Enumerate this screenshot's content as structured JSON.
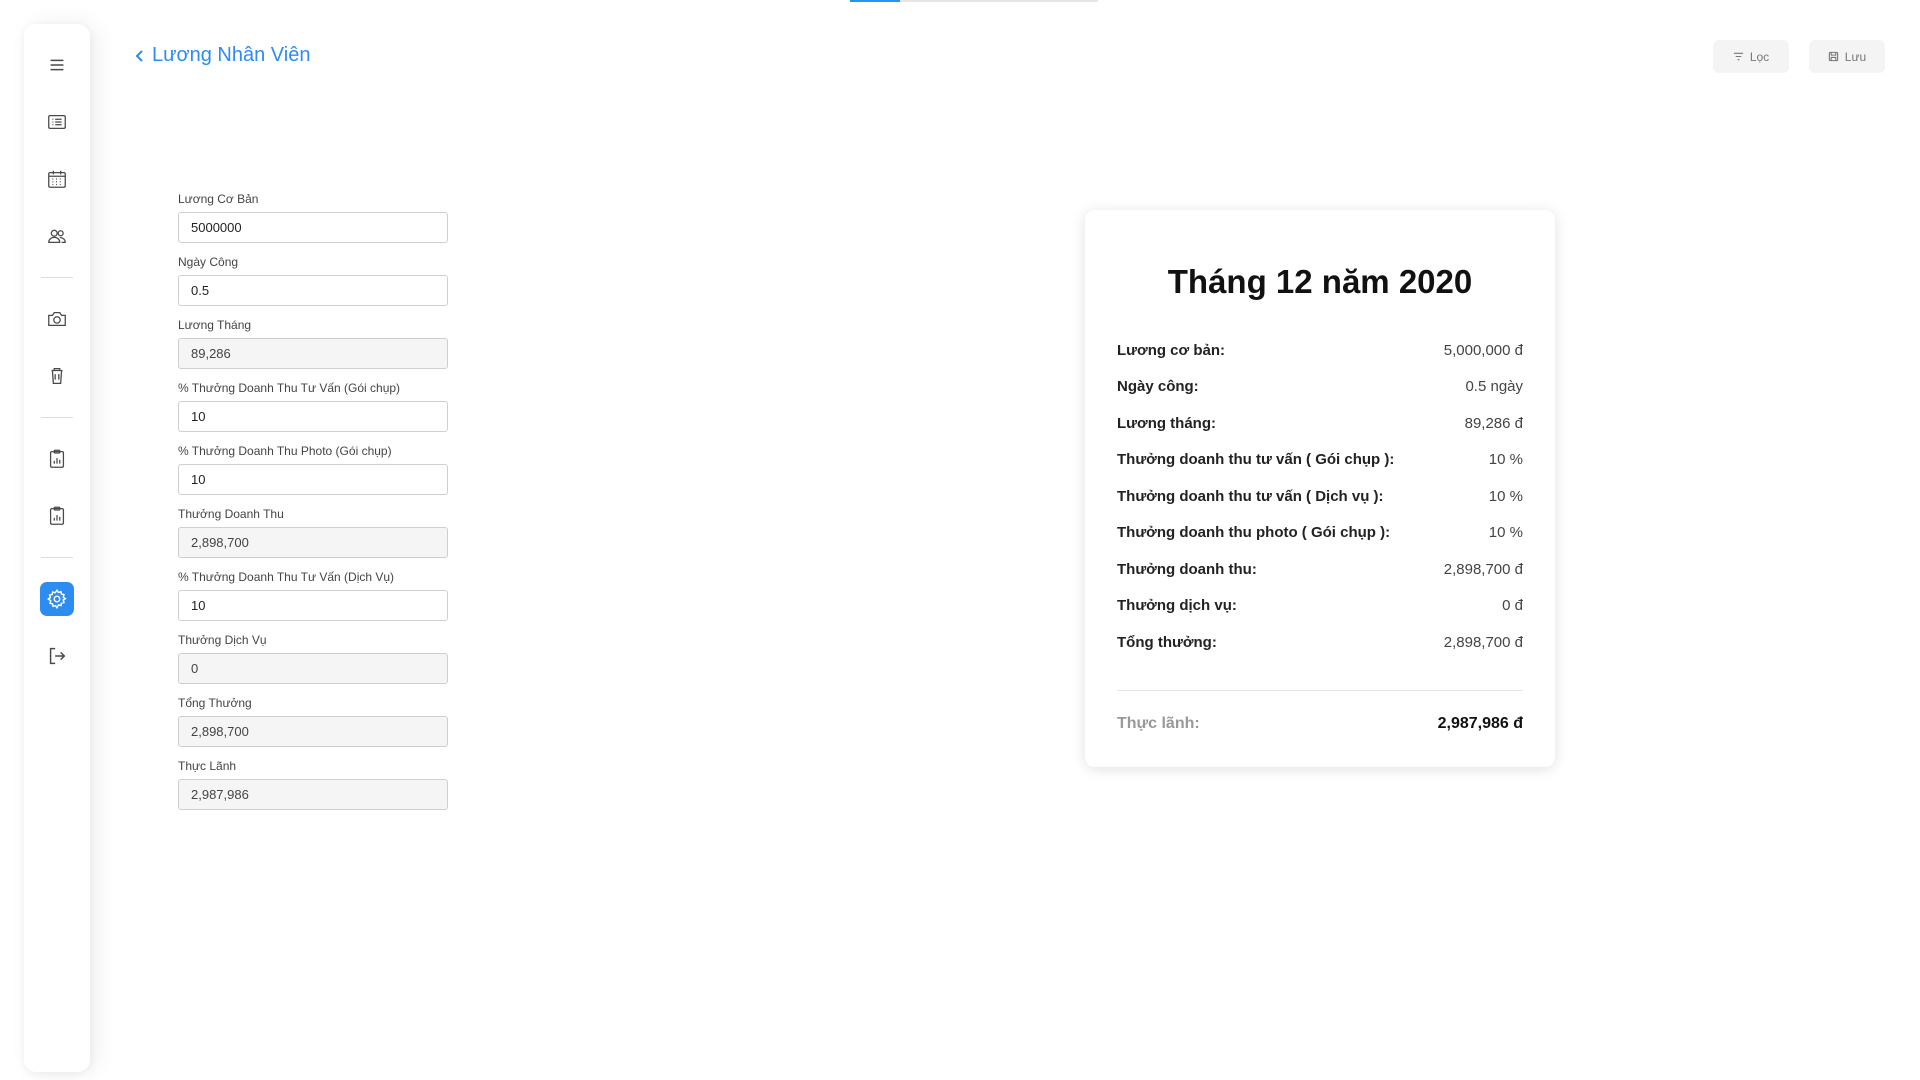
{
  "progress": {
    "fraction": 0.2
  },
  "sidebar": {
    "items": [
      {
        "icon": "menu-icon"
      },
      {
        "icon": "list-icon"
      },
      {
        "icon": "calendar-icon"
      },
      {
        "icon": "users-icon"
      },
      {
        "icon": "camera-icon"
      },
      {
        "icon": "trash-icon"
      },
      {
        "icon": "clipboard-chart-icon"
      },
      {
        "icon": "clipboard-chart-icon"
      },
      {
        "icon": "gear-icon",
        "active": true
      },
      {
        "icon": "logout-icon"
      }
    ],
    "accent": "#2d8cf0"
  },
  "header": {
    "title": "Lương Nhân Viên",
    "filter_label": "Lọc",
    "save_label": "Lưu"
  },
  "form": {
    "fields": [
      {
        "label": "Lương Cơ Bản",
        "value": "5000000",
        "readonly": false
      },
      {
        "label": "Ngày Công",
        "value": "0.5",
        "readonly": false
      },
      {
        "label": "Lương Tháng",
        "value": "89,286",
        "readonly": true
      },
      {
        "label": "% Thưởng Doanh Thu Tư Vấn (Gói chụp)",
        "value": "10",
        "readonly": false
      },
      {
        "label": "% Thưởng Doanh Thu Photo (Gói chụp)",
        "value": "10",
        "readonly": false
      },
      {
        "label": "Thưởng Doanh Thu",
        "value": "2,898,700",
        "readonly": true
      },
      {
        "label": "% Thưởng Doanh Thu Tư Vấn (Dịch Vụ)",
        "value": "10",
        "readonly": false
      },
      {
        "label": "Thưởng Dịch Vụ",
        "value": "0",
        "readonly": true
      },
      {
        "label": "Tổng Thưởng",
        "value": "2,898,700",
        "readonly": true
      },
      {
        "label": "Thực Lãnh",
        "value": "2,987,986",
        "readonly": true
      }
    ]
  },
  "summary": {
    "title": "Tháng 12 năm 2020",
    "rows": [
      {
        "label": "Lương cơ bản:",
        "value": "5,000,000 đ"
      },
      {
        "label": "Ngày công:",
        "value": "0.5 ngày"
      },
      {
        "label": "Lương tháng:",
        "value": "89,286 đ"
      },
      {
        "label": "Thưởng doanh thu tư vấn ( Gói chụp ):",
        "value": "10 %"
      },
      {
        "label": "Thưởng doanh thu tư vấn ( Dịch vụ ):",
        "value": "10 %"
      },
      {
        "label": "Thưởng doanh thu photo ( Gói chụp ):",
        "value": "10 %"
      },
      {
        "label": "Thưởng doanh thu:",
        "value": "2,898,700 đ"
      },
      {
        "label": "Thưởng dịch vụ:",
        "value": "0 đ"
      },
      {
        "label": "Tổng thưởng:",
        "value": "2,898,700 đ"
      }
    ],
    "total_label": "Thực lãnh:",
    "total_value": "2,987,986 đ"
  }
}
